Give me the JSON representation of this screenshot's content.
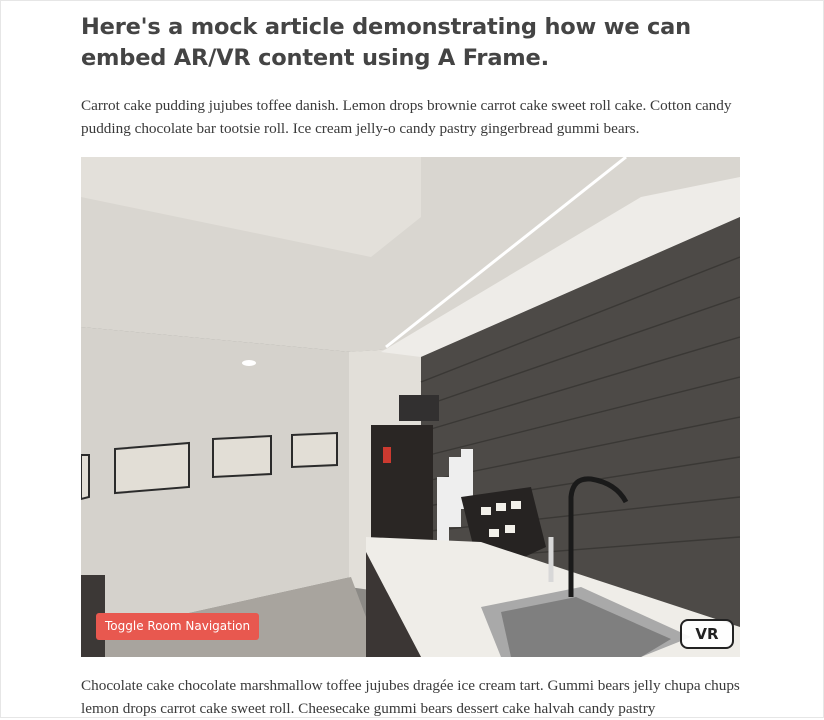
{
  "article": {
    "title": "Here's a mock article demonstrating how we can embed AR/VR content using A Frame.",
    "paragraph1": "Carrot cake pudding jujubes toffee danish. Lemon drops brownie carrot cake sweet roll cake. Cotton candy pudding chocolate bar tootsie roll. Ice cream jelly-o candy pastry gingerbread gummi bears.",
    "paragraph2": "Chocolate cake chocolate marshmallow toffee jujubes dragée ice cream tart. Gummi bears jelly chupa chups lemon drops carrot cake sweet roll. Cheesecake gummi bears dessert cake halvah candy pastry"
  },
  "scene": {
    "toggle_label": "Toggle Room Navigation",
    "vr_label": "VR",
    "toggle_color": "#e8584f",
    "vr_icon": "vr-headset-button"
  },
  "colors": {
    "title": "#444444",
    "body_text": "#3a3a3a"
  }
}
